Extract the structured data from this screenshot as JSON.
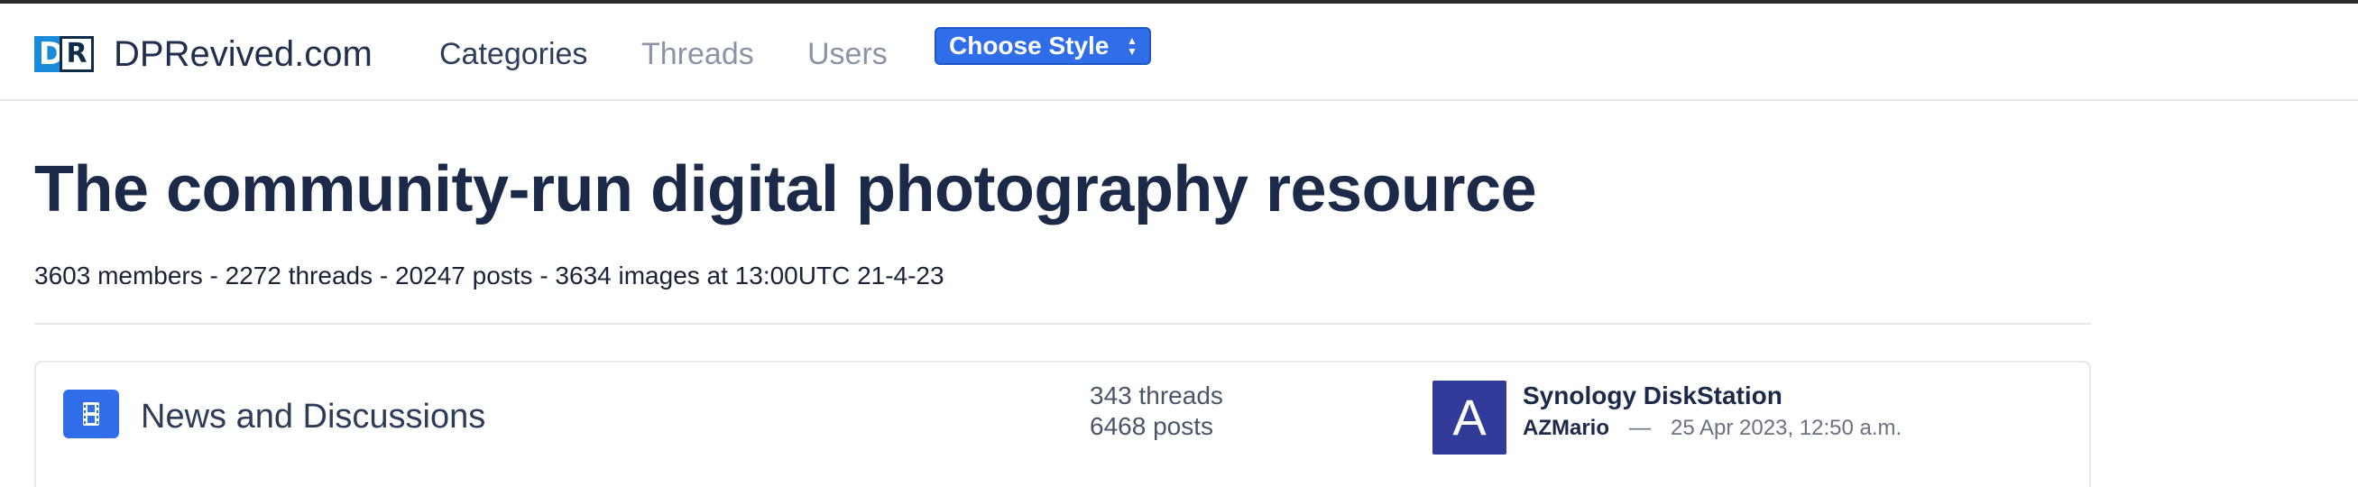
{
  "site": {
    "name": "DPRevived.com",
    "logo_letters": [
      "D",
      "R"
    ]
  },
  "nav": {
    "items": [
      {
        "label": "Categories",
        "active": true
      },
      {
        "label": "Threads",
        "active": false
      },
      {
        "label": "Users",
        "active": false
      }
    ],
    "style_select": {
      "selected": "Choose Style"
    }
  },
  "hero": {
    "title": "The community-run digital photography resource",
    "stats": "3603 members - 2272 threads - 20247 posts - 3634 images at 13:00UTC 21-4-23"
  },
  "categories": [
    {
      "icon": "film-icon",
      "title": "News and Discussions",
      "threads": "343 threads",
      "posts": "6468 posts",
      "latest": {
        "avatar_letter": "A",
        "thread_title": "Synology DiskStation",
        "user": "AZMario",
        "separator": "—",
        "time": "25 Apr 2023, 12:50 a.m."
      }
    }
  ],
  "colors": {
    "accent": "#2f6ee8",
    "avatar_bg": "#313c9a",
    "heading": "#1c2a4a",
    "muted": "#8a94a6"
  }
}
